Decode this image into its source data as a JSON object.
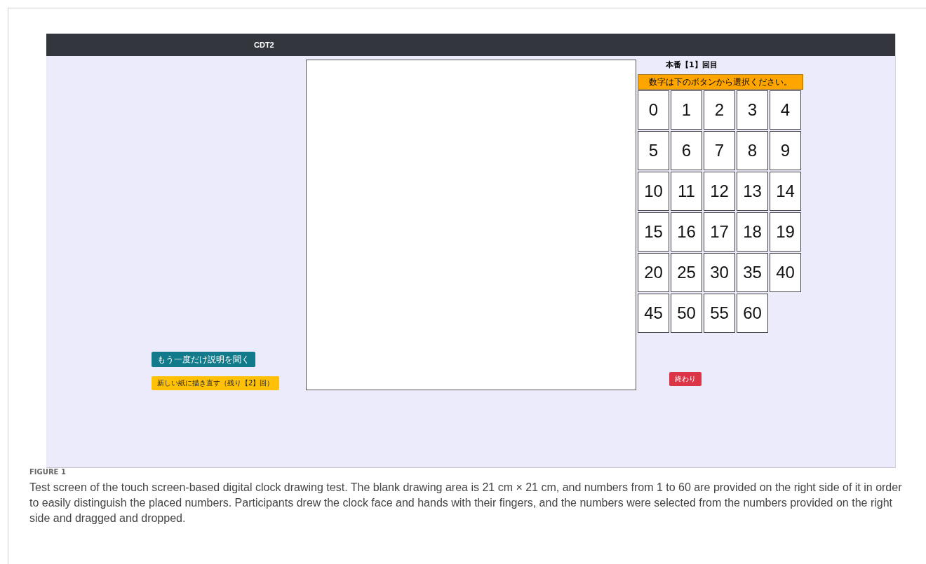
{
  "header": {
    "title": "CDT2"
  },
  "round_title": "本番【1】回目",
  "instruction": "数字は下のボタンから選択ください。",
  "number_buttons": [
    "0",
    "1",
    "2",
    "3",
    "4",
    "5",
    "6",
    "7",
    "8",
    "9",
    "10",
    "11",
    "12",
    "13",
    "14",
    "15",
    "16",
    "17",
    "18",
    "19",
    "20",
    "25",
    "30",
    "35",
    "40",
    "45",
    "50",
    "55",
    "60"
  ],
  "left_buttons": [
    {
      "label": "もう一度だけ説明を聞く",
      "kind": "info"
    },
    {
      "label": "新しい紙に描き直す（残り【2】回）",
      "kind": "warning"
    }
  ],
  "end_button": {
    "label": "終わり",
    "kind": "danger"
  },
  "caption": {
    "label": "FIGURE 1",
    "text": "Test screen of the touch screen-based digital clock drawing test. The blank drawing area is 21 cm × 21 cm, and numbers from 1 to 60 are provided on the right side of it in order to easily distinguish the placed numbers. Participants drew the clock face and hands with their fingers, and the numbers were selected from the numbers provided on the right side and dragged and dropped."
  }
}
